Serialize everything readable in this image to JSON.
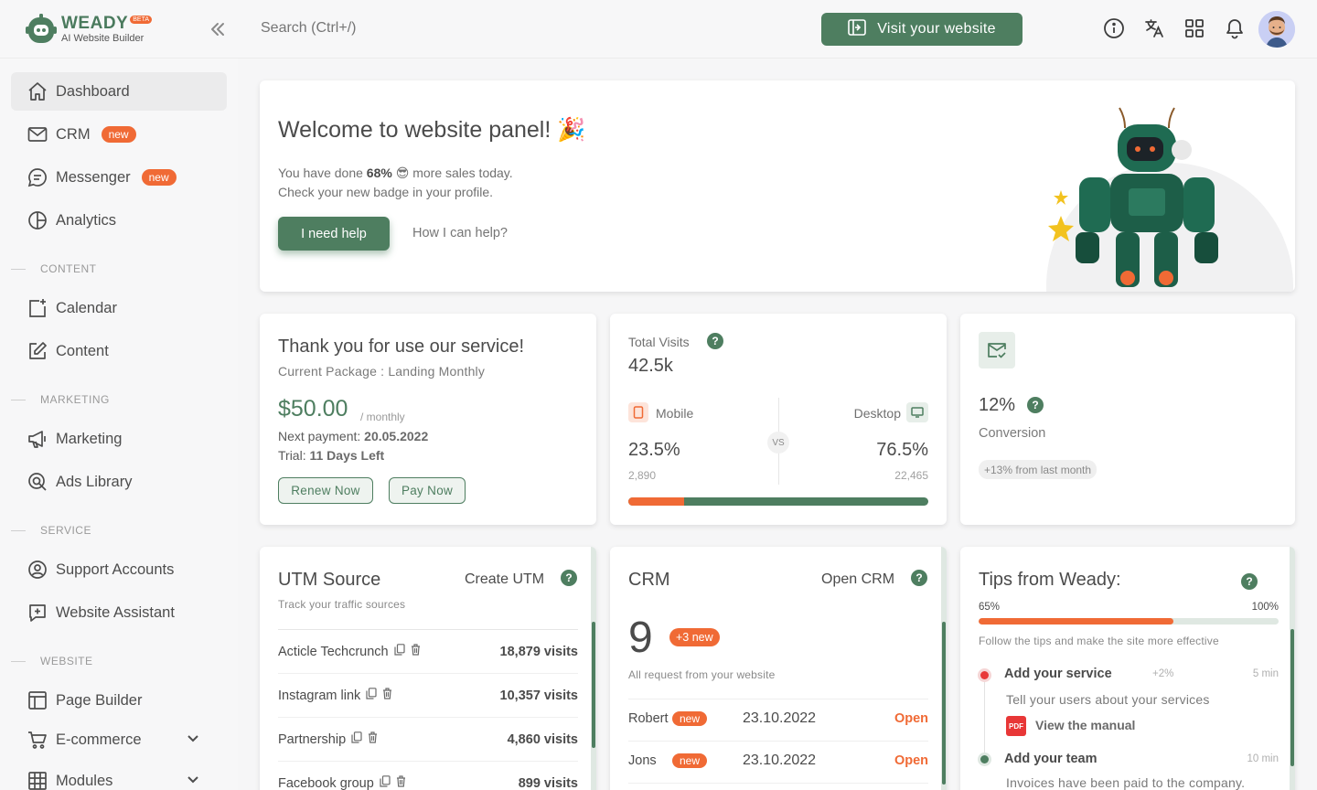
{
  "brand": {
    "name": "WEADY",
    "beta": "BETA",
    "tagline": "AI Website Builder"
  },
  "search": {
    "placeholder": "Search (Ctrl+/)"
  },
  "header": {
    "visit_label": "Visit your website"
  },
  "sidebar": {
    "items": [
      {
        "label": "Dashboard"
      },
      {
        "label": "CRM",
        "badge": "new"
      },
      {
        "label": "Messenger",
        "badge": "new"
      },
      {
        "label": "Analytics"
      },
      {
        "label": "Calendar"
      },
      {
        "label": "Content"
      },
      {
        "label": "Marketing"
      },
      {
        "label": "Ads Library"
      },
      {
        "label": "Support Accounts"
      },
      {
        "label": "Website Assistant"
      },
      {
        "label": "Page Builder"
      },
      {
        "label": "E-commerce"
      },
      {
        "label": "Modules"
      }
    ],
    "sections": [
      "CONTENT",
      "MARKETING",
      "SERVICE",
      "WEBSITE"
    ]
  },
  "welcome": {
    "title": "Welcome to website panel! 🎉",
    "line1_a": "You have done ",
    "line1_b": "68%",
    "line1_c": " 😎 more sales today.",
    "line2": "Check your new badge in your profile.",
    "help_btn": "I need help",
    "how_link": "How I can help?"
  },
  "subscription": {
    "title": "Thank you for use our service!",
    "package": "Current Package : Landing Monthly",
    "price": "$50.00",
    "period": "/ monthly",
    "next_label": "Next payment: ",
    "next_value": "20.05.2022",
    "trial_label": "Trial: ",
    "trial_value": "11 Days Left",
    "renew": "Renew Now",
    "pay": "Pay Now"
  },
  "visits": {
    "label": "Total Visits",
    "q": "?",
    "total": "42.5k",
    "mobile_label": "Mobile",
    "desktop_label": "Desktop",
    "vs": "VS",
    "mobile_pct": "23.5%",
    "desktop_pct": "76.5%",
    "mobile_count": "2,890",
    "desktop_count": "22,465",
    "mobile_share": 0.185
  },
  "conversion": {
    "value": "12%",
    "q": "?",
    "label": "Conversion",
    "delta": "+13% from last month"
  },
  "utm": {
    "title": "UTM Source",
    "action": "Create UTM",
    "q": "?",
    "subtitle": "Track your traffic sources",
    "rows": [
      {
        "name": "Acticle Techcrunch",
        "visits": "18,879 visits"
      },
      {
        "name": "Instagram link",
        "visits": "10,357 visits"
      },
      {
        "name": "Partnership",
        "visits": "4,860 visits"
      },
      {
        "name": "Facebook group",
        "visits": "899 visits"
      }
    ]
  },
  "crm": {
    "title": "CRM",
    "action": "Open CRM",
    "q": "?",
    "count": "9",
    "new_badge": "+3 new",
    "caption": "All request from your website",
    "rows": [
      {
        "name": "Robert",
        "badge": "new",
        "date": "23.10.2022",
        "action": "Open"
      },
      {
        "name": "Jons",
        "badge": "new",
        "date": "23.10.2022",
        "action": "Open"
      }
    ]
  },
  "tips": {
    "title": "Tips from Weady:",
    "q": "?",
    "progress_label": "65%",
    "progress_max": "100%",
    "progress": 0.65,
    "caption": "Follow the tips and make the site more effective",
    "items": [
      {
        "title": "Add your service",
        "gain": "+2%",
        "time": "5 min",
        "desc": "Tell your users about your services",
        "link": "View the manual",
        "pdf": "PDF"
      },
      {
        "title": "Add your team",
        "time": "10 min",
        "desc": "Invoices have been paid to the company."
      }
    ]
  },
  "colors": {
    "accent": "#4e7e60",
    "orange": "#f06a35"
  }
}
